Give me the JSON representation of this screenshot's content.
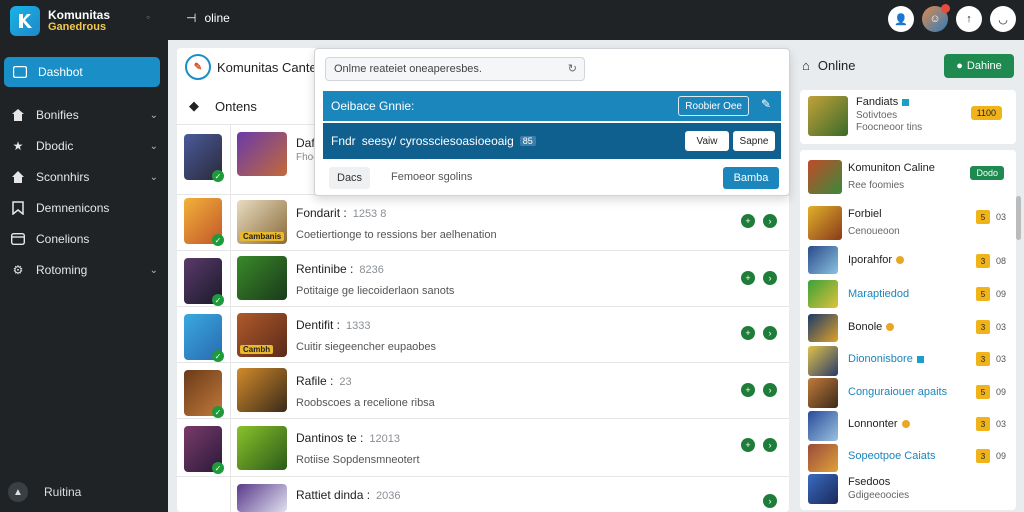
{
  "brand": {
    "line1": "Komunitas",
    "line2": "Ganedrous"
  },
  "sidebar": {
    "active": "Dashbot",
    "items": [
      {
        "label": "Bonifies",
        "icon": "home-icon",
        "chevron": true
      },
      {
        "label": "Dbodic",
        "icon": "star-icon",
        "chevron": true
      },
      {
        "label": "Sconnhirs",
        "icon": "house-icon",
        "chevron": true
      },
      {
        "label": "Demnenicons",
        "icon": "bookmark-icon",
        "chevron": false
      },
      {
        "label": "Conelions",
        "icon": "window-icon",
        "chevron": false
      },
      {
        "label": "Rotoming",
        "icon": "gear-icon",
        "chevron": true
      }
    ],
    "footer": "Ruitina"
  },
  "topbar": {
    "menu": "oline"
  },
  "main": {
    "header": "Komunitas Cante",
    "subheader": "Ontens",
    "rows": [
      {
        "title": "Dafi",
        "num": "",
        "desc": ""
      },
      {
        "title": "Fhodi",
        "num": "",
        "desc": ""
      },
      {
        "title": "Fondarit :",
        "num": "1253 8",
        "desc": "Coetiertionge to ressions ber aelhenation",
        "tag": "Cambanis"
      },
      {
        "title": "Rentinibe :",
        "num": "8236",
        "desc": "Potitaige ge liecoiderlaon sanots",
        "tag": ""
      },
      {
        "title": "Dentifit :",
        "num": "1333",
        "desc": "Cuitir siegeencher eupaobes",
        "tag": "Cambh"
      },
      {
        "title": "Rafile :",
        "num": "23",
        "desc": "Roobscoes a recelione ribsa",
        "tag": ""
      },
      {
        "title": "Dantinos te :",
        "num": "12013",
        "desc": "Rotiise Sopdensmneotert",
        "tag": ""
      },
      {
        "title": "Rattiet dinda :",
        "num": "2036",
        "desc": "",
        "tag": ""
      }
    ]
  },
  "popup": {
    "search_placeholder": "Onlme reateiet oneaperesbes.",
    "bar1_label": "Oeibace Gnnie:",
    "bar1_button": "Roobier Oee",
    "bar2_label": "Fndr",
    "bar2_text": "seesy/ cyrossciesoasioeoaig",
    "bar2_chip": "85",
    "btn_view": "Vaiw",
    "btn_save": "Sapne",
    "footer_button": "Dacs",
    "footer_text": "Femoeor sgolins",
    "primary": "Bamba"
  },
  "right": {
    "title": "Online",
    "green_button": "Dahine",
    "featured": {
      "name": "Fandiats",
      "sub1": "Sotivtoes",
      "sub2": "Foocneoor tins",
      "tag": "1100"
    },
    "list": [
      {
        "name": "Komuniton Caline",
        "sub": "Ree foomies",
        "pill": "Dodo",
        "pill_color": "green"
      },
      {
        "name": "Forbiel",
        "sub": "Cenoueoon",
        "tag": "5",
        "count": "03"
      },
      {
        "name": "Iporahfor",
        "sub": "",
        "tag": "3",
        "count": "08",
        "dot": "yellow"
      },
      {
        "name": "Maraptiedod",
        "sub": "",
        "tag": "5",
        "count": "09",
        "blue": true
      },
      {
        "name": "Bonole",
        "sub": "",
        "tag": "3",
        "count": "03",
        "dot": "yellow"
      },
      {
        "name": "Diononisbore",
        "sub": "",
        "tag": "3",
        "count": "03",
        "blue": true,
        "dot": "blue"
      },
      {
        "name": "Conguraiouer apaits",
        "sub": "",
        "tag": "5",
        "count": "09",
        "blue": true
      },
      {
        "name": "Lonnonter",
        "sub": "",
        "tag": "3",
        "count": "03",
        "dot": "yellow"
      },
      {
        "name": "Sopeotpoe Caiats",
        "sub": "",
        "tag": "3",
        "count": "09",
        "blue": true
      },
      {
        "name": "Fsedoos",
        "sub": "Gdigeeoocies",
        "tag": "",
        "count": ""
      }
    ]
  }
}
